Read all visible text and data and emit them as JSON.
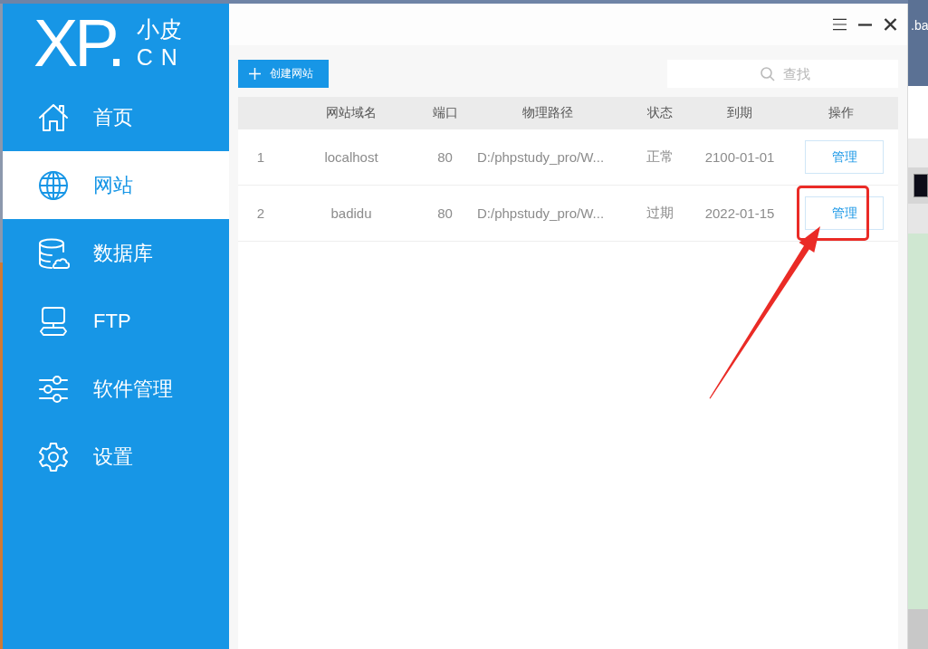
{
  "desktop": {
    "visible_text": ".ba"
  },
  "sidebar": {
    "logo": {
      "mark": "XP.",
      "line_1": "小皮",
      "line_2": "CN"
    },
    "items": [
      {
        "label": "首页",
        "selected": false
      },
      {
        "label": "网站",
        "selected": true
      },
      {
        "label": "数据库",
        "selected": false
      },
      {
        "label": "FTP",
        "selected": false
      },
      {
        "label": "软件管理",
        "selected": false
      },
      {
        "label": "设置",
        "selected": false
      }
    ]
  },
  "toolbar": {
    "create_button": "创建网站",
    "search": {
      "placeholder": "查找"
    }
  },
  "table": {
    "columns": [
      "网站域名",
      "端口",
      "物理路径",
      "状态",
      "到期",
      "操作"
    ],
    "rows": [
      {
        "index": "1",
        "domain": "localhost",
        "port": "80",
        "path": "D:/phpstudy_pro/W...",
        "status": "正常",
        "expiry": "2100-01-01",
        "action": "管理",
        "annotated": false
      },
      {
        "index": "2",
        "domain": "badidu",
        "port": "80",
        "path": "D:/phpstudy_pro/W...",
        "status": "过期",
        "expiry": "2022-01-15",
        "action": "管理",
        "annotated": true
      }
    ]
  }
}
